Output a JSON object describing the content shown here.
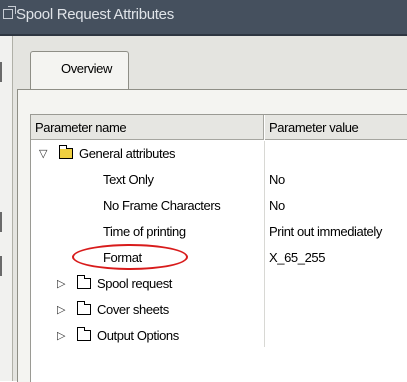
{
  "window": {
    "title": "Spool Request Attributes"
  },
  "tabs": [
    {
      "label": "Overview",
      "active": true
    }
  ],
  "table": {
    "headers": {
      "name": "Parameter name",
      "value": "Parameter value"
    },
    "root": {
      "label": "General attributes",
      "expanded": true,
      "icon": "folder-open-icon"
    },
    "attributes": [
      {
        "name": "Text Only",
        "value": "No"
      },
      {
        "name": "No Frame Characters",
        "value": "No"
      },
      {
        "name": "Time of printing",
        "value": "Print out immediately"
      },
      {
        "name": "Format",
        "value": "X_65_255",
        "highlighted": true
      }
    ],
    "folders": [
      {
        "label": "Spool request",
        "expanded": false,
        "icon": "folder-icon"
      },
      {
        "label": "Cover sheets",
        "expanded": false,
        "icon": "folder-icon"
      },
      {
        "label": "Output Options",
        "expanded": false,
        "icon": "folder-icon"
      }
    ]
  },
  "colors": {
    "titlebar": "#45505e",
    "frame": "#e4e4e0",
    "highlight_circle": "#d81b1b",
    "folder_open": "#f0d040"
  }
}
